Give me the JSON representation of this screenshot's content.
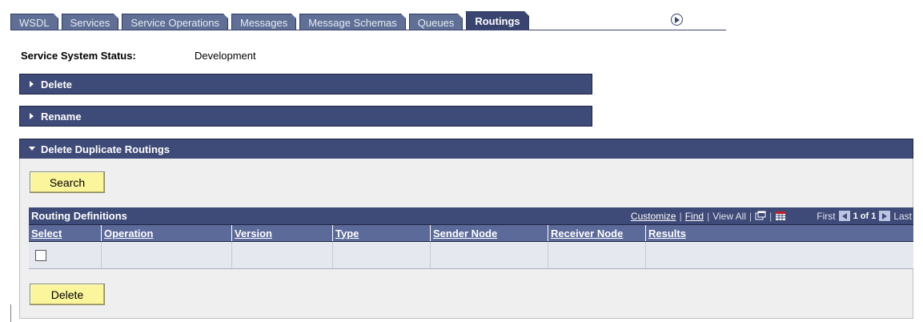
{
  "tabs": [
    {
      "label": "WSDL"
    },
    {
      "label": "Services"
    },
    {
      "label": "Service Operations"
    },
    {
      "label": "Messages"
    },
    {
      "label": "Message Schemas"
    },
    {
      "label": "Queues"
    },
    {
      "label": "Routings",
      "active": true
    }
  ],
  "status": {
    "label": "Service System Status:",
    "value": "Development"
  },
  "sections": {
    "delete": "Delete",
    "rename": "Rename",
    "delete_duplicate": "Delete Duplicate Routings"
  },
  "buttons": {
    "search": "Search",
    "delete": "Delete"
  },
  "grid": {
    "title": "Routing Definitions",
    "customize": "Customize",
    "find": "Find",
    "view_all": "View All",
    "first": "First",
    "page": "1 of 1",
    "last": "Last",
    "columns": [
      "Select",
      "Operation",
      "Version",
      "Type",
      "Sender Node",
      "Receiver Node",
      "Results"
    ],
    "rows": [
      {
        "select": false,
        "operation": "",
        "version": "",
        "type": "",
        "sender_node": "",
        "receiver_node": "",
        "results": ""
      }
    ]
  },
  "colors": {
    "bar": "#3e4a77",
    "tab": "#5f6f96",
    "button": "#fbf59b",
    "panel": "#efefef"
  }
}
